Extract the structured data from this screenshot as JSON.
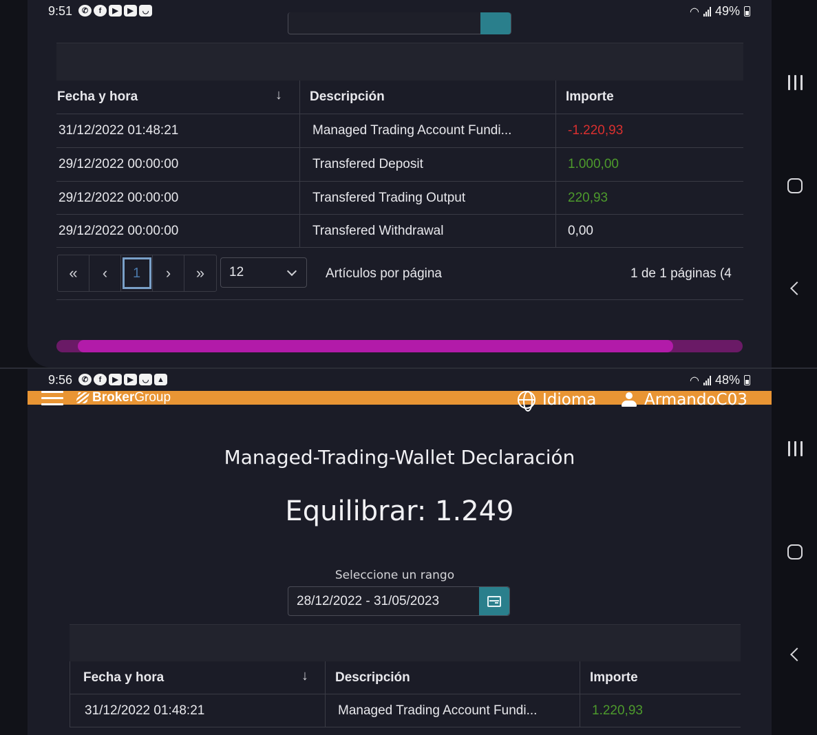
{
  "top": {
    "status": {
      "time": "9:51",
      "battery": "49%"
    },
    "table": {
      "headers": {
        "date": "Fecha y hora",
        "desc": "Descripción",
        "amount": "Importe"
      },
      "rows": [
        {
          "date": "31/12/2022 01:48:21",
          "desc": "Managed Trading Account Fundi...",
          "amount": "-1.220,93",
          "tone": "neg"
        },
        {
          "date": "29/12/2022 00:00:00",
          "desc": "Transfered Deposit",
          "amount": "1.000,00",
          "tone": "pos"
        },
        {
          "date": "29/12/2022 00:00:00",
          "desc": "Transfered Trading Output",
          "amount": "220,93",
          "tone": "pos"
        },
        {
          "date": "29/12/2022 00:00:00",
          "desc": "Transfered Withdrawal",
          "amount": "0,00",
          "tone": "plain"
        }
      ]
    },
    "pager": {
      "first": "«",
      "prev": "‹",
      "current": "1",
      "next": "›",
      "last": "»",
      "page_size": "12",
      "per_page_label": "Artículos por página",
      "summary": "1 de 1 páginas (4"
    }
  },
  "bottom": {
    "status": {
      "time": "9:56",
      "battery": "48%"
    },
    "header": {
      "brand_bold": "Broker",
      "brand_light": "Group",
      "language": "Idioma",
      "user": "ArmandoC03"
    },
    "page_title": "Managed-Trading-Wallet Declaración",
    "balance": "Equilibrar: 1.249",
    "range_label": "Seleccione un rango",
    "range_value": "28/12/2022 - 31/05/2023",
    "table": {
      "headers": {
        "date": "Fecha y hora",
        "desc": "Descripción",
        "amount": "Importe"
      },
      "rows": [
        {
          "date": "31/12/2022 01:48:21",
          "desc": "Managed Trading Account Fundi...",
          "amount": "1.220,93",
          "tone": "pos"
        }
      ]
    }
  },
  "colors": {
    "accent_orange": "#e99534",
    "scroll_pink": "#b21ba9",
    "calendar_teal": "#2a7f8c",
    "negative": "#d9302f",
    "positive": "#4d9a2c"
  }
}
